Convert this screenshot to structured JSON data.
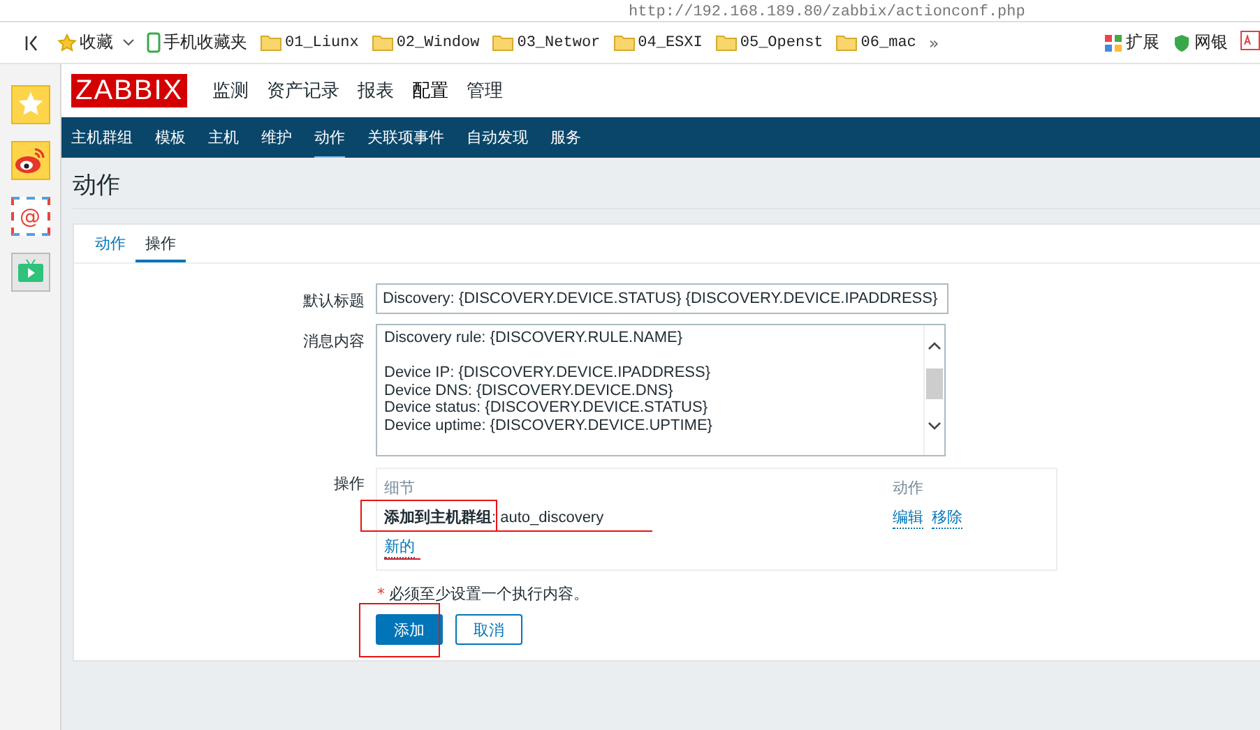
{
  "browser": {
    "url": "http://192.168.189.80/zabbix/actionconf.php",
    "bookmarks": [
      {
        "label": "收藏",
        "kind": "star"
      },
      {
        "label": "手机收藏夹",
        "kind": "phone"
      },
      {
        "label": "01_Liunx",
        "kind": "folder"
      },
      {
        "label": "02_Window",
        "kind": "folder"
      },
      {
        "label": "03_Networ",
        "kind": "folder"
      },
      {
        "label": "04_ESXI",
        "kind": "folder"
      },
      {
        "label": "05_Openst",
        "kind": "folder"
      },
      {
        "label": "06_mac",
        "kind": "folder"
      }
    ],
    "more": "»",
    "extensions": "扩展",
    "bank": "网银"
  },
  "sidebar": [
    {
      "kind": "star"
    },
    {
      "kind": "weibo"
    },
    {
      "kind": "mail",
      "glyph": "@"
    },
    {
      "kind": "tv"
    }
  ],
  "logo": "ZABBIX",
  "main_menu": [
    {
      "label": "监测",
      "selected": false
    },
    {
      "label": "资产记录",
      "selected": false
    },
    {
      "label": "报表",
      "selected": false
    },
    {
      "label": "配置",
      "selected": true
    },
    {
      "label": "管理",
      "selected": false
    }
  ],
  "sub_menu": [
    {
      "label": "主机群组",
      "selected": false
    },
    {
      "label": "模板",
      "selected": false
    },
    {
      "label": "主机",
      "selected": false
    },
    {
      "label": "维护",
      "selected": false
    },
    {
      "label": "动作",
      "selected": true
    },
    {
      "label": "关联项事件",
      "selected": false
    },
    {
      "label": "自动发现",
      "selected": false
    },
    {
      "label": "服务",
      "selected": false
    }
  ],
  "page_title": "动作",
  "tabs": [
    {
      "label": "动作",
      "selected": false
    },
    {
      "label": "操作",
      "selected": true
    }
  ],
  "form": {
    "default_subject": {
      "label": "默认标题",
      "value": "Discovery: {DISCOVERY.DEVICE.STATUS} {DISCOVERY.DEVICE.IPADDRESS}"
    },
    "message": {
      "label": "消息内容",
      "paragraphs": [
        [
          "Discovery rule: {DISCOVERY.RULE.NAME}"
        ],
        [
          "Device IP: {DISCOVERY.DEVICE.IPADDRESS}",
          "Device DNS: {DISCOVERY.DEVICE.DNS}",
          "Device status: {DISCOVERY.DEVICE.STATUS}",
          "Device uptime: {DISCOVERY.DEVICE.UPTIME}"
        ]
      ]
    },
    "operations": {
      "label": "操作",
      "columns": [
        "细节",
        "动作"
      ],
      "rows": [
        {
          "detail_label": "添加到主机群组",
          "detail_value": ": auto_discovery",
          "actions": [
            "编辑",
            "移除"
          ],
          "highlighted": true
        }
      ],
      "new_link": {
        "label": "新的",
        "underlined": true
      }
    },
    "note_mark": "*",
    "note": "必须至少设置一个执行内容。",
    "buttons": [
      {
        "label": "添加",
        "kind": "primary",
        "highlighted": true
      },
      {
        "label": "取消",
        "kind": "secondary",
        "highlighted": false
      }
    ]
  }
}
